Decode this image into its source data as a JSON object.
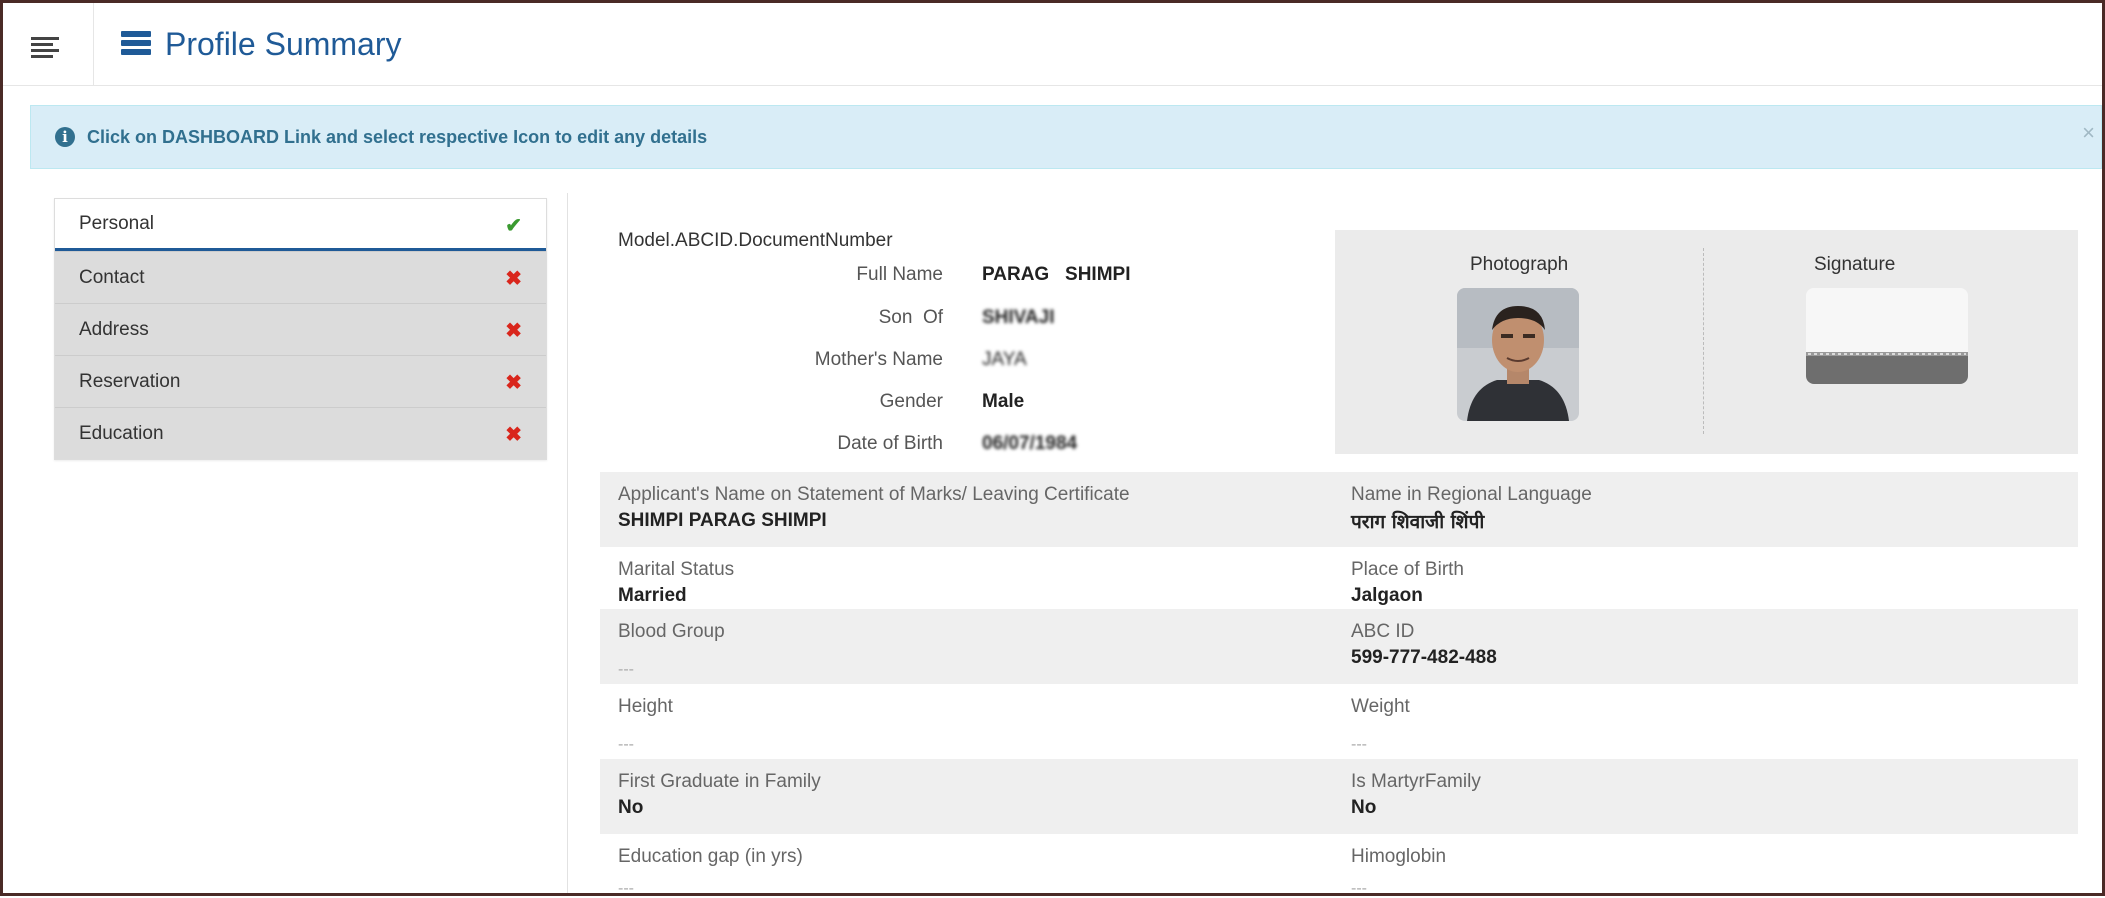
{
  "header": {
    "title": "Profile Summary"
  },
  "alert": {
    "text": "Click on DASHBOARD Link and select respective Icon to edit any details",
    "close": "×"
  },
  "tabs": [
    {
      "label": "Personal",
      "status": "✔",
      "complete": true
    },
    {
      "label": "Contact",
      "status": "✖",
      "complete": false
    },
    {
      "label": "Address",
      "status": "✖",
      "complete": false
    },
    {
      "label": "Reservation",
      "status": "✖",
      "complete": false
    },
    {
      "label": "Education",
      "status": "✖",
      "complete": false
    }
  ],
  "profile": {
    "doc_number_label": "Model.ABCID.DocumentNumber",
    "full_name": {
      "label": "Full Name",
      "value": "PARAG   SHIMPI"
    },
    "son_of": {
      "label": "Son  Of",
      "value": "SHIVAJI"
    },
    "mother_name": {
      "label": "Mother's Name",
      "value": "JAYA"
    },
    "gender": {
      "label": "Gender",
      "value": "Male"
    },
    "dob": {
      "label": "Date of Birth",
      "value": "06/07/1984"
    }
  },
  "media": {
    "photo_label": "Photograph",
    "signature_label": "Signature"
  },
  "details": [
    {
      "left": {
        "label": "Applicant's Name on Statement of Marks/ Leaving Certificate",
        "value": "SHIMPI PARAG SHIMPI"
      },
      "right": {
        "label": "Name in Regional Language",
        "value": "पराग शिवाजी शिंपी"
      }
    },
    {
      "left": {
        "label": "Marital Status",
        "value": "Married"
      },
      "right": {
        "label": "Place of Birth",
        "value": "Jalgaon"
      }
    },
    {
      "left": {
        "label": "Blood Group",
        "value": "---"
      },
      "right": {
        "label": "ABC ID",
        "value": "599-777-482-488"
      }
    },
    {
      "left": {
        "label": "Height",
        "value": "---"
      },
      "right": {
        "label": "Weight",
        "value": "---"
      }
    },
    {
      "left": {
        "label": "First Graduate in Family",
        "value": "No"
      },
      "right": {
        "label": "Is MartyrFamily",
        "value": "No"
      }
    },
    {
      "left": {
        "label": "Education gap (in yrs)",
        "value": "---"
      },
      "right": {
        "label": "Himoglobin",
        "value": "---"
      }
    }
  ],
  "colors": {
    "primary": "#1f5a97",
    "alert_bg": "#d9edf7",
    "alert_text": "#31708f",
    "ok": "#3a9a30",
    "error": "#d9261c"
  }
}
